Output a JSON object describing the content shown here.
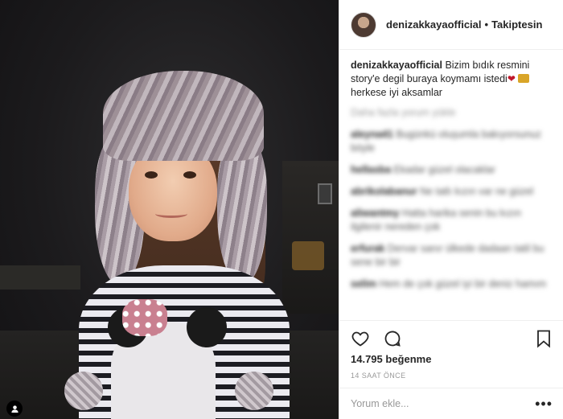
{
  "post": {
    "username": "denizakkayaofficial",
    "follow_status": "Takiptesin",
    "separator": "•",
    "caption": {
      "author": "denizakkayaofficial",
      "text_line1": "Bizim bıdık resmini story'e degil buraya koymamı istedi",
      "text_line2": "herkese iyi aksamlar"
    },
    "blurred_comments": [
      {
        "text": "Daha fazla yorum yükle"
      },
      {
        "user": "aleyna41",
        "text": "Bugünkü oluşumla bakıyorsunuz",
        "extra": "böyle"
      },
      {
        "user": "hellasba",
        "text": "Ekadar güzel olacaklar"
      },
      {
        "user": "abrikolabanur",
        "text": "Ne tatlı kızın var",
        "extra": "ne güzel"
      },
      {
        "user": "aliwantmy",
        "text": "Hatta harika senin bu kızın",
        "extra": "ilgilenir nereden çok"
      },
      {
        "user": "erfurak",
        "text": "Dervar sanır ülkede",
        "extra": "dadaan tatil bu sene bir bir"
      },
      {
        "user": "selim",
        "text": "Hem de çok güzel iyi",
        "extra": "bir deniz hamım"
      }
    ],
    "likes_text": "14.795 beğenme",
    "timestamp": "14 SAAT ÖNCE",
    "comment_placeholder": "Yorum ekle...",
    "more_label": "•••"
  },
  "icons": {
    "like": "heart-icon",
    "comment": "comment-bubble-icon",
    "save": "bookmark-icon",
    "tag": "person-tag-icon"
  },
  "colors": {
    "text": "#262626",
    "muted": "#999999",
    "border": "#efefef"
  }
}
